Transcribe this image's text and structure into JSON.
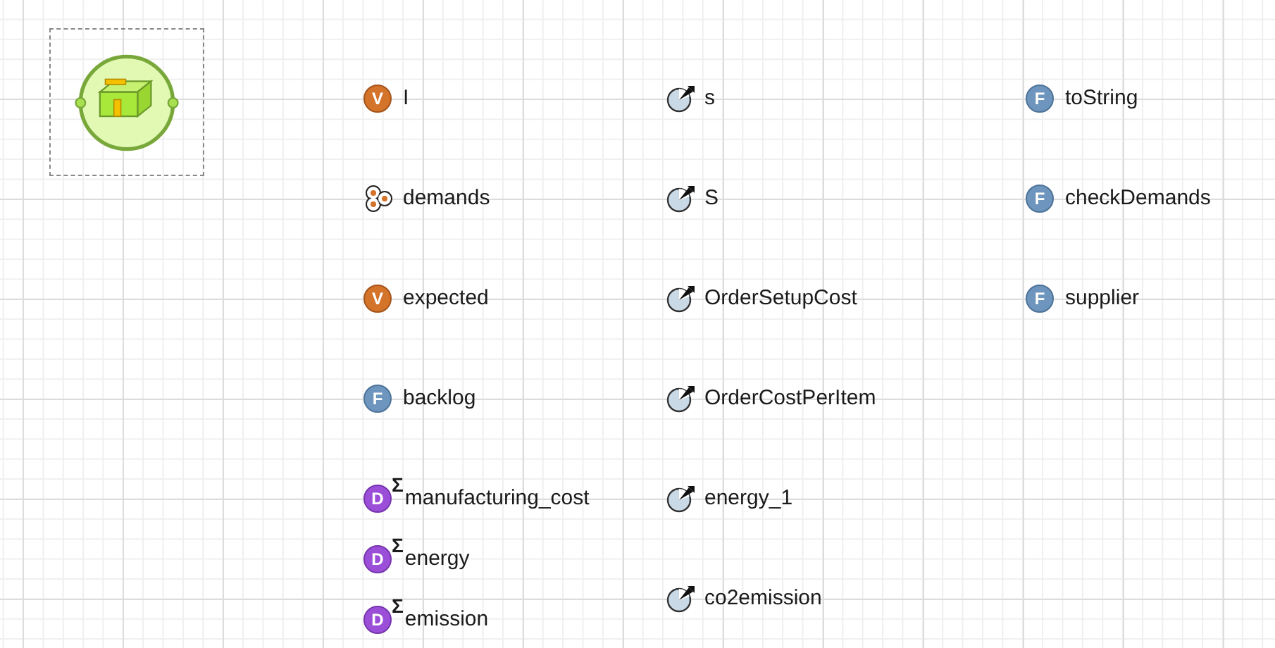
{
  "agent": {
    "kind": "agent"
  },
  "columns": [
    {
      "items": [
        {
          "kind": "variable",
          "badge": "V",
          "name": "I"
        },
        {
          "kind": "collection",
          "name": "demands"
        },
        {
          "kind": "variable",
          "badge": "V",
          "name": "expected"
        },
        {
          "kind": "function",
          "badge": "F",
          "name": "backlog"
        },
        {
          "kind": "dataset",
          "badge": "D",
          "mark": "Σ",
          "name": "manufacturing_cost"
        },
        {
          "kind": "dataset",
          "badge": "D",
          "mark": "Σ",
          "name": "energy"
        },
        {
          "kind": "dataset",
          "badge": "D",
          "mark": "Σ",
          "name": "emission"
        }
      ]
    },
    {
      "items": [
        {
          "kind": "parameter",
          "name": "s"
        },
        {
          "kind": "parameter",
          "name": "S"
        },
        {
          "kind": "parameter",
          "name": "OrderSetupCost"
        },
        {
          "kind": "parameter",
          "name": "OrderCostPerItem"
        },
        {
          "kind": "parameter",
          "name": "energy_1"
        },
        {
          "kind": "parameter",
          "name": "co2emission"
        }
      ]
    },
    {
      "items": [
        {
          "kind": "function",
          "badge": "F",
          "name": "toString"
        },
        {
          "kind": "function",
          "badge": "F",
          "name": "checkDemands"
        },
        {
          "kind": "function",
          "badge": "F",
          "name": "supplier"
        }
      ]
    }
  ]
}
